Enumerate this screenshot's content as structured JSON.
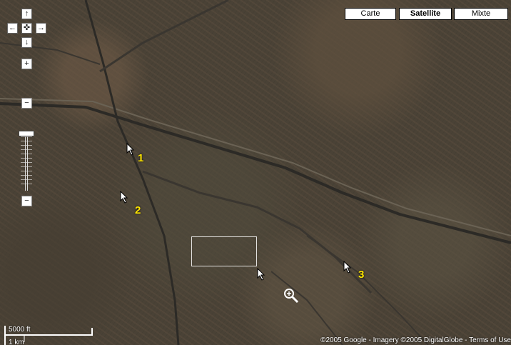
{
  "map_types": [
    {
      "label": "Carte",
      "selected": false
    },
    {
      "label": "Satellite",
      "selected": true
    },
    {
      "label": "Mixte",
      "selected": false
    }
  ],
  "pan_controls": {
    "up": "↑",
    "left": "←",
    "center": "✜",
    "right": "→",
    "down": "↓"
  },
  "zoom_controls": {
    "zoom_in_top": "+",
    "zoom_in": "−",
    "zoom_out": "−"
  },
  "markers": [
    "1",
    "2",
    "3"
  ],
  "scale": {
    "feet": "5000 ft",
    "km": "1 km"
  },
  "copyright": "©2005 Google - Imagery ©2005 DigitalGlobe - Terms of Use",
  "colors": {
    "marker": "#ffe600",
    "button_bg": "#ffffff"
  }
}
